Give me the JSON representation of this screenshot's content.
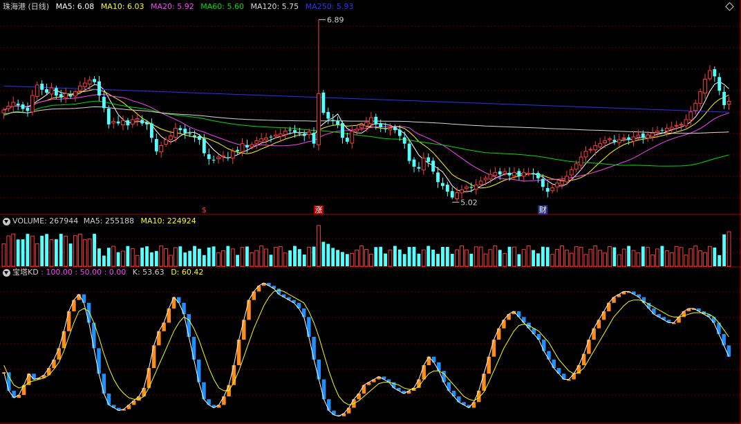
{
  "colors": {
    "background": "#000000",
    "grid": "#6a0000",
    "up": "#ff3c3c",
    "down": "#54ffff",
    "ma5": "#ffffff",
    "ma10": "#ffff00",
    "ma20": "#ff40ff",
    "ma60": "#00e000",
    "ma120": "#d8d8d8",
    "ma250": "#3030ff",
    "kd_up": "#ff8c1a",
    "kd_down": "#1e90ff",
    "kline": "#ffffff",
    "dline": "#ffff00"
  },
  "main_panel": {
    "title": "珠海港 (日线)",
    "ma5": "MA5: 6.08",
    "ma10": "MA10: 6.03",
    "ma20": "MA20: 5.92",
    "ma60": "MA60: 5.60",
    "ma120": "MA120: 5.75",
    "ma250": "MA250: 5.93",
    "high_label": "6.89",
    "low_label": "5.02",
    "markers": [
      {
        "text": "$",
        "color": "#ff3c3c",
        "index": 42
      },
      {
        "text": "涨",
        "color": "#ffffff",
        "bg": "#b00000",
        "index": 66
      },
      {
        "text": "财",
        "color": "#ffffff",
        "bg": "#303090",
        "index": 113
      }
    ],
    "settings_icon": "diamond-icon"
  },
  "volume_panel": {
    "volume": "VOLUME: 267944",
    "ma5": "MA5: 255188",
    "ma10": "MA10: 224924"
  },
  "kd_panel": {
    "name": "宝塔KD",
    "levels": ": 100.00 : 50.00 : 0.00",
    "k": "K: 53.63",
    "d": "D: 60.42"
  },
  "chart_data": {
    "type": "candlestick",
    "description_ref": "daily candles with MA overlays, volume and KD sub-panels",
    "price_range": [
      4.95,
      6.95
    ],
    "kd_range": [
      0,
      100
    ],
    "closes": [
      5.95,
      5.99,
      6.03,
      6.0,
      5.96,
      5.94,
      6.1,
      6.21,
      6.16,
      6.13,
      6.18,
      6.1,
      6.08,
      6.12,
      6.09,
      6.14,
      6.2,
      6.23,
      6.26,
      6.24,
      6.1,
      5.97,
      5.8,
      5.83,
      5.81,
      5.84,
      5.79,
      5.85,
      5.86,
      5.81,
      5.8,
      5.66,
      5.52,
      5.58,
      5.64,
      5.68,
      5.76,
      5.74,
      5.71,
      5.7,
      5.67,
      5.64,
      5.5,
      5.44,
      5.43,
      5.46,
      5.47,
      5.45,
      5.52,
      5.52,
      5.6,
      5.56,
      5.59,
      5.63,
      5.65,
      5.66,
      5.67,
      5.69,
      5.7,
      5.73,
      5.74,
      5.72,
      5.7,
      5.68,
      5.72,
      5.6,
      6.12,
      5.92,
      5.86,
      5.84,
      5.8,
      5.66,
      5.62,
      5.73,
      5.75,
      5.79,
      5.82,
      5.87,
      5.8,
      5.77,
      5.75,
      5.76,
      5.74,
      5.68,
      5.6,
      5.42,
      5.36,
      5.34,
      5.45,
      5.41,
      5.31,
      5.2,
      5.16,
      5.1,
      5.04,
      5.09,
      5.12,
      5.15,
      5.14,
      5.17,
      5.21,
      5.24,
      5.28,
      5.3,
      5.28,
      5.31,
      5.27,
      5.3,
      5.26,
      5.3,
      5.29,
      5.28,
      5.24,
      5.15,
      5.1,
      5.14,
      5.19,
      5.21,
      5.26,
      5.33,
      5.39,
      5.46,
      5.52,
      5.54,
      5.58,
      5.6,
      5.63,
      5.65,
      5.62,
      5.64,
      5.66,
      5.64,
      5.67,
      5.69,
      5.66,
      5.69,
      5.71,
      5.73,
      5.74,
      5.76,
      5.77,
      5.79,
      5.8,
      5.85,
      5.93,
      6.02,
      6.14,
      6.27,
      6.36,
      6.3,
      6.15,
      6.0,
      6.04
    ],
    "kd_k": [
      35,
      22,
      17,
      19,
      26,
      34,
      30,
      31,
      33,
      38,
      44,
      52,
      64,
      78,
      86,
      90,
      84,
      70,
      52,
      34,
      20,
      12,
      10,
      8,
      9,
      12,
      15,
      18,
      24,
      38,
      54,
      64,
      70,
      80,
      88,
      84,
      76,
      60,
      44,
      28,
      16,
      12,
      10,
      12,
      18,
      26,
      40,
      58,
      72,
      86,
      92,
      96,
      98,
      96,
      94,
      90,
      88,
      86,
      84,
      80,
      74,
      60,
      44,
      30,
      16,
      8,
      5,
      4,
      6,
      10,
      16,
      20,
      26,
      28,
      30,
      32,
      30,
      28,
      24,
      22,
      20,
      22,
      24,
      30,
      40,
      46,
      42,
      36,
      28,
      22,
      18,
      14,
      12,
      10,
      14,
      22,
      34,
      46,
      58,
      66,
      72,
      76,
      78,
      74,
      70,
      66,
      62,
      58,
      50,
      44,
      38,
      34,
      30,
      30,
      34,
      40,
      48,
      58,
      66,
      72,
      78,
      84,
      88,
      90,
      92,
      92,
      90,
      88,
      84,
      80,
      76,
      74,
      72,
      70,
      70,
      74,
      78,
      80,
      80,
      78,
      76,
      74,
      70,
      62,
      54,
      46
    ],
    "kd_d": [
      40,
      32,
      26,
      24,
      25,
      28,
      29,
      30,
      31,
      33,
      37,
      42,
      50,
      60,
      70,
      78,
      80,
      78,
      70,
      60,
      48,
      38,
      30,
      24,
      20,
      17,
      16,
      16,
      18,
      24,
      32,
      40,
      48,
      56,
      64,
      70,
      74,
      72,
      66,
      58,
      48,
      38,
      30,
      24,
      22,
      22,
      28,
      36,
      46,
      56,
      66,
      74,
      82,
      88,
      92,
      93,
      92,
      90,
      88,
      86,
      84,
      78,
      70,
      60,
      48,
      36,
      26,
      18,
      14,
      12,
      13,
      15,
      18,
      21,
      24,
      27,
      28,
      28,
      27,
      26,
      24,
      23,
      23,
      25,
      30,
      34,
      36,
      36,
      34,
      30,
      26,
      22,
      18,
      16,
      15,
      17,
      21,
      28,
      36,
      44,
      52,
      58,
      64,
      68,
      69,
      68,
      66,
      64,
      60,
      56,
      50,
      44,
      40,
      36,
      34,
      35,
      38,
      44,
      50,
      56,
      62,
      68,
      74,
      78,
      82,
      85,
      86,
      86,
      85,
      83,
      81,
      79,
      77,
      75,
      74,
      74,
      75,
      76,
      77,
      77,
      77,
      76,
      74,
      70,
      65,
      60
    ]
  }
}
